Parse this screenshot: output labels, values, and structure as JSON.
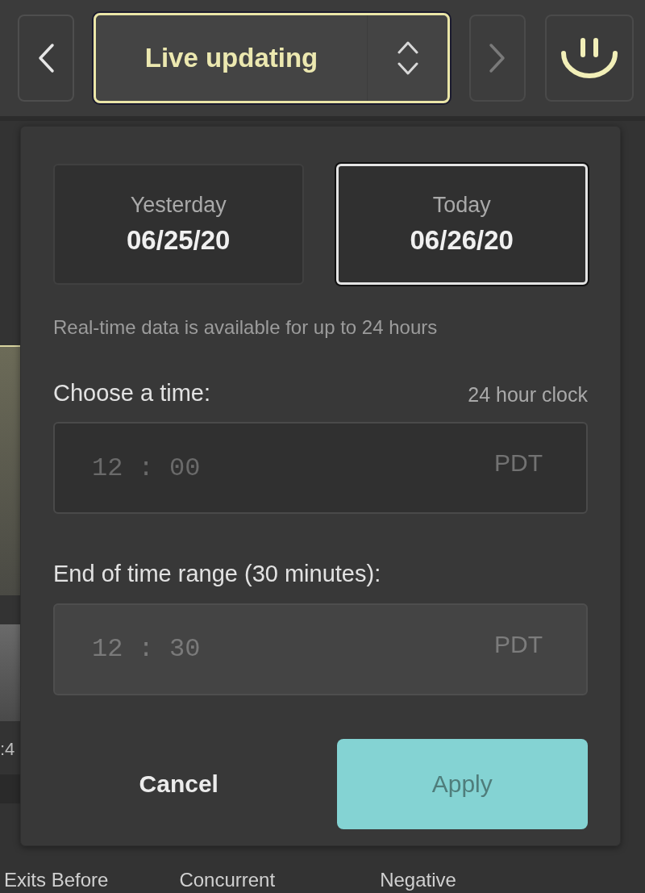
{
  "toolbar": {
    "prev": {
      "disabled": false
    },
    "mode_select": {
      "value": "Live updating"
    },
    "next": {
      "disabled": true
    }
  },
  "date_picker": {
    "days": [
      {
        "label": "Yesterday",
        "date": "06/25/20",
        "selected": false
      },
      {
        "label": "Today",
        "date": "06/26/20",
        "selected": true
      }
    ],
    "note": "Real-time data is available for up to 24 hours",
    "time_fields": [
      {
        "label": "Choose a time:",
        "hint": "24 hour clock",
        "placeholder": "12 : 00",
        "zone": "PDT",
        "disabled": false
      },
      {
        "label": "End of time range (30 minutes):",
        "placeholder": "12 : 30",
        "zone": "PDT",
        "disabled": true
      }
    ],
    "buttons": {
      "cancel": "Cancel",
      "apply": "Apply"
    }
  },
  "background": {
    "axis_fragment": ":4",
    "columns": [
      "Exits Before",
      "Concurrent",
      "Negative"
    ]
  }
}
